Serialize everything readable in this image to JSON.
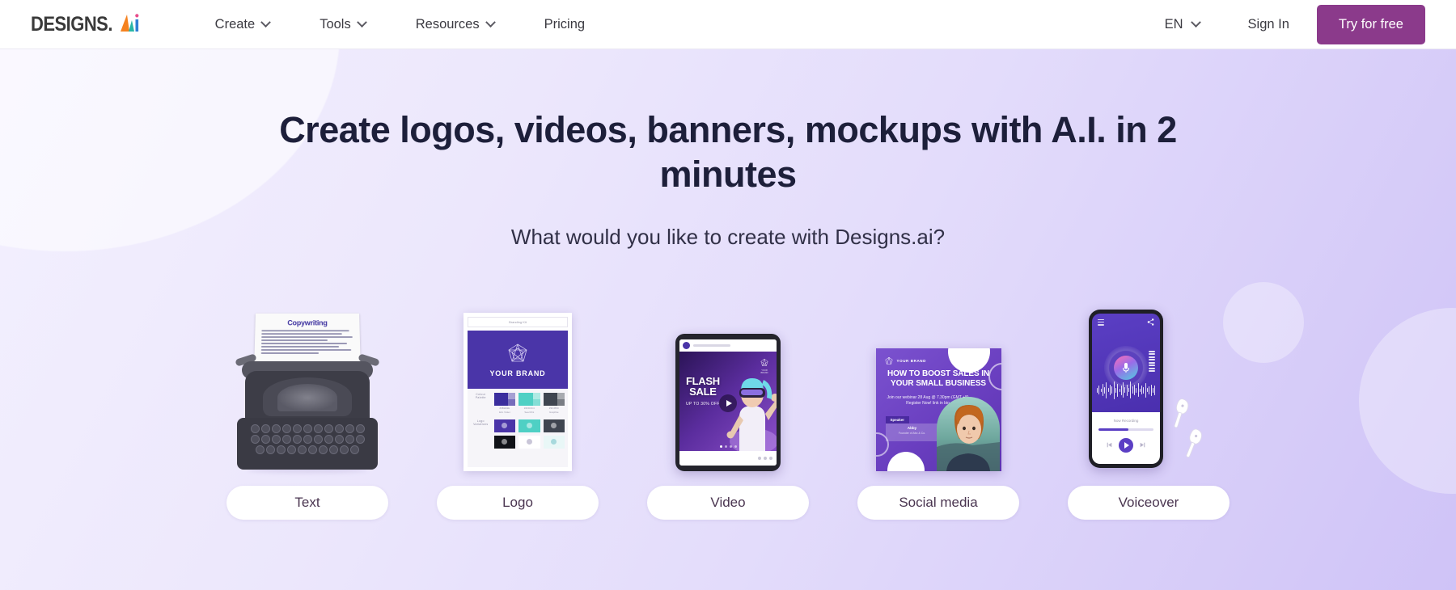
{
  "navbar": {
    "logo": {
      "word": "DESIGNS.",
      "mark_alt": "ai-logo-mark",
      "colors": [
        "#f58220",
        "#28b7a6",
        "#2f7fd4",
        "#e84c8b"
      ]
    },
    "links": [
      {
        "label": "Create",
        "has_caret": true
      },
      {
        "label": "Tools",
        "has_caret": true
      },
      {
        "label": "Resources",
        "has_caret": true
      },
      {
        "label": "Pricing",
        "has_caret": false
      }
    ],
    "language": {
      "label": "EN",
      "has_caret": true
    },
    "sign_in": "Sign In",
    "cta": {
      "label": "Try for free",
      "color": "#8b3a8b"
    }
  },
  "hero": {
    "headline": "Create logos, videos, banners, mockups with A.I. in 2 minutes",
    "subheadline": "What would you like to create with Designs.ai?",
    "background": {
      "from": "#f3f0fe",
      "to": "#cfc3f7"
    }
  },
  "cards": [
    {
      "id": "text",
      "label": "Text",
      "thumb": "typewriter-thumbnail",
      "paper_title": "Copywriting"
    },
    {
      "id": "logo",
      "label": "Logo",
      "thumb": "brand-guideline-sheet-thumbnail",
      "sheet_topbar": "Branding Kit",
      "brand_text": "YOUR BRAND",
      "section_labels": [
        "Colour Palette",
        "Logo Variations"
      ],
      "swatch_names": [
        "Elm Violet",
        "Sea Mint",
        "Graphite"
      ],
      "swatch_colors": [
        "#3b2e9e",
        "#4fd0c4",
        "#3f4550"
      ]
    },
    {
      "id": "video",
      "label": "Video",
      "thumb": "tablet-video-thumbnail",
      "video_title": "FLASH SALE",
      "video_sub": "UP TO 30% OFF"
    },
    {
      "id": "social-media",
      "label": "Social media",
      "thumb": "social-post-thumbnail",
      "brand_badge": "YOUR BRAND",
      "post_title": "HOW TO BOOST SALES IN YOUR SMALL BUSINESS",
      "post_sub": "Join our webinar 28 Aug @ 7.30pm (GMT +8) Register Now! link in bio",
      "speaker_tag": "Speaker",
      "speaker_name": "Abby",
      "speaker_role": "Founder of Abc & Co."
    },
    {
      "id": "voiceover",
      "label": "Voiceover",
      "thumb": "phone-voiceover-thumbnail",
      "now_playing": "Now Recording",
      "progress": 55
    }
  ]
}
